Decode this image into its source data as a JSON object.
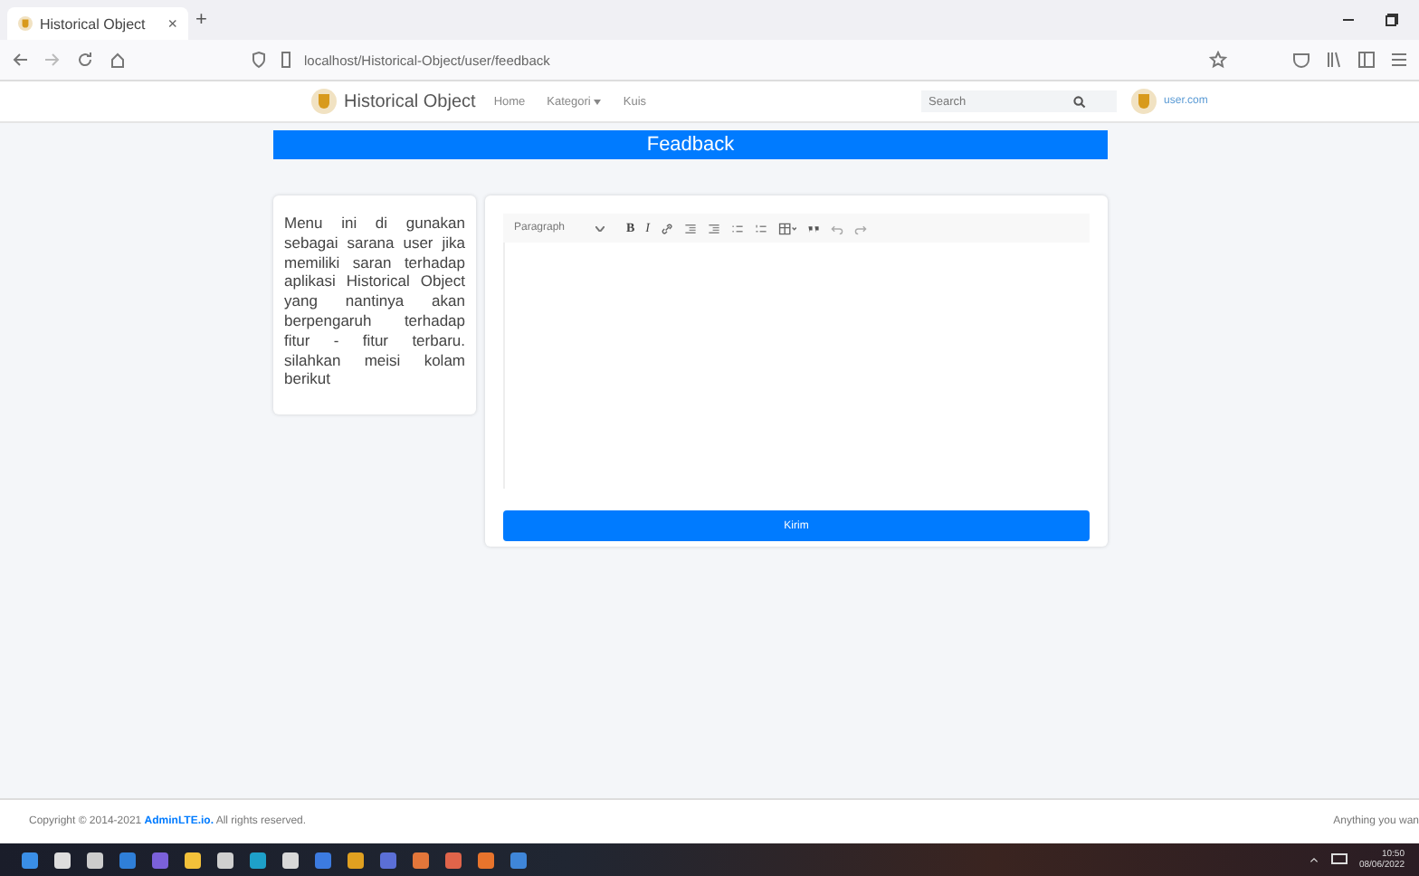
{
  "browser": {
    "tab_title": "Historical Object",
    "tab_close": "×",
    "new_tab": "+",
    "url": "localhost/Historical-Object/user/feedback"
  },
  "navbar": {
    "brand": "Historical Object",
    "links": [
      {
        "label": "Home",
        "dropdown": false
      },
      {
        "label": "Kategori",
        "dropdown": true
      },
      {
        "label": "Kuis",
        "dropdown": false
      }
    ],
    "search": {
      "placeholder": "Search"
    },
    "user": "user.com"
  },
  "page": {
    "title": "Feadback",
    "description": "Menu ini di gunakan sebagai sarana user jika memiliki saran terhadap aplikasi Historical Object yang nantinya akan berpengaruh terhadap fitur - fitur terbaru. silahkan meisi kolam berikut"
  },
  "editor": {
    "format": "Paragraph",
    "tools": [
      {
        "kind": "bold",
        "glyph": "B"
      },
      {
        "kind": "italic",
        "glyph": "I"
      },
      {
        "kind": "link"
      },
      {
        "kind": "outdent"
      },
      {
        "kind": "indent"
      },
      {
        "kind": "bullets"
      },
      {
        "kind": "numbers"
      },
      {
        "kind": "table"
      },
      {
        "kind": "quote"
      },
      {
        "kind": "undo"
      },
      {
        "kind": "redo"
      }
    ],
    "submit": "Kirim"
  },
  "footer": {
    "copyright": "Copyright © 2014-2021 **AdminLTE.io.** All rights reserved.",
    "right": "Anything you wan"
  },
  "taskbar": {
    "icons": [
      {
        "color": "#3a8ee6"
      },
      {
        "color": "#dddddd"
      },
      {
        "color": "#cccccc"
      },
      {
        "color": "#2f7fd8"
      },
      {
        "color": "#7b61d9"
      },
      {
        "color": "#f3c13a"
      },
      {
        "color": "#cfcfcf"
      },
      {
        "color": "#1ea0c9"
      },
      {
        "color": "#d8d8d8"
      },
      {
        "color": "#3c7be0"
      },
      {
        "color": "#e0a020"
      },
      {
        "color": "#5b6fd6"
      },
      {
        "color": "#e2763a"
      },
      {
        "color": "#e0644a"
      },
      {
        "color": "#e8742c"
      },
      {
        "color": "#3f86d8"
      }
    ],
    "time": "10:50",
    "date": "08/06/2022"
  }
}
